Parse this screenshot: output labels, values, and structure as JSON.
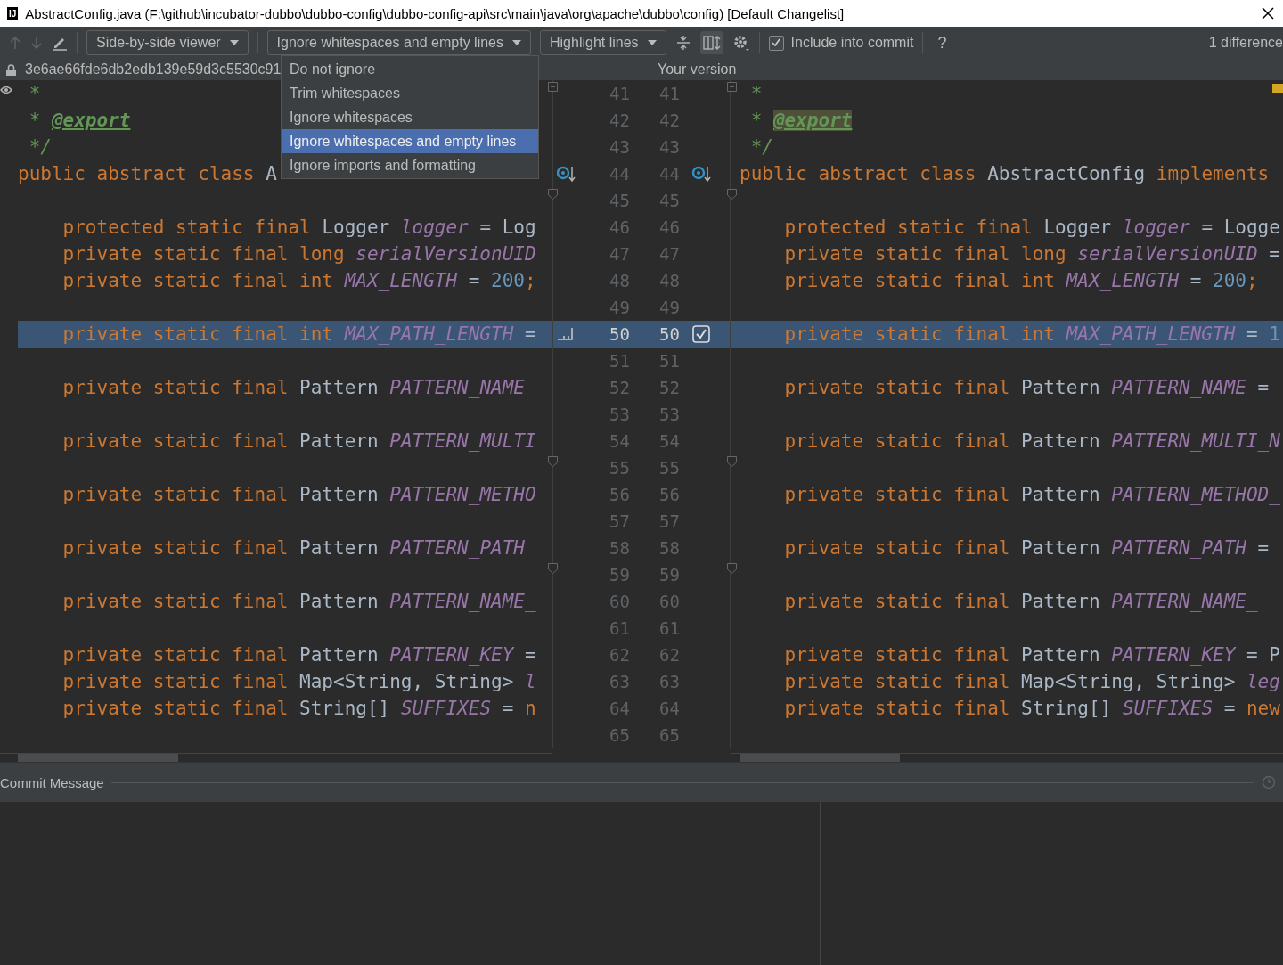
{
  "window": {
    "title": "AbstractConfig.java (F:\\github\\incubator-dubbo\\dubbo-config\\dubbo-config-api\\src\\main\\java\\org\\apache\\dubbo\\config) [Default Changelist]",
    "app_icon": "IJ"
  },
  "toolbar": {
    "viewer": "Side-by-side viewer",
    "ignore": "Ignore whitespaces and empty lines",
    "highlight": "Highlight lines",
    "include_into_commit": {
      "label": "Include into commit",
      "checked": true
    },
    "help": "?",
    "differences": "1 difference"
  },
  "ignore_menu": [
    {
      "label": "Do not ignore",
      "selected": false
    },
    {
      "label": "Trim whitespaces",
      "selected": false
    },
    {
      "label": "Ignore whitespaces",
      "selected": false
    },
    {
      "label": "Ignore whitespaces and empty lines",
      "selected": true
    },
    {
      "label": "Ignore imports and formatting",
      "selected": false
    }
  ],
  "left_header": "3e6ae66fde6db2edb139e59d3c5530c91",
  "right_header": "Your version",
  "lines": [
    {
      "left_no": "41",
      "right_no": "41",
      "fold_open": true,
      "highlighted": false,
      "left": [
        {
          "kind": "doc",
          "text": " *"
        }
      ],
      "right": [
        {
          "kind": "doc",
          "text": " *"
        }
      ]
    },
    {
      "left_no": "42",
      "right_no": "42",
      "highlighted": false,
      "left": [
        {
          "kind": "doc",
          "text": " * "
        },
        {
          "kind": "tag",
          "text": "@export"
        }
      ],
      "right": [
        {
          "kind": "doc",
          "text": " * "
        },
        {
          "kind": "tag_changed",
          "text": "@export"
        }
      ]
    },
    {
      "left_no": "43",
      "right_no": "43",
      "highlighted": false,
      "left": [
        {
          "kind": "doc",
          "text": " */"
        }
      ],
      "right": [
        {
          "kind": "doc",
          "text": " */"
        }
      ]
    },
    {
      "left_no": "44",
      "right_no": "44",
      "highlighted": false,
      "navigate": true,
      "left": [
        {
          "kind": "kw",
          "text": "public abstract class "
        },
        {
          "kind": "plain",
          "text": "A"
        }
      ],
      "right": [
        {
          "kind": "kw",
          "text": "public abstract class "
        },
        {
          "kind": "plain",
          "text": "AbstractConfig "
        },
        {
          "kind": "kw",
          "text": "implements"
        }
      ]
    },
    {
      "left_no": "45",
      "right_no": "45",
      "fold_close": true,
      "highlighted": false
    },
    {
      "left_no": "46",
      "right_no": "46",
      "highlighted": false,
      "left": [
        {
          "kind": "kw",
          "text": "    protected static final "
        },
        {
          "kind": "plain",
          "text": "Logger "
        },
        {
          "kind": "const",
          "text": "logger"
        },
        {
          "kind": "plain",
          "text": " = Log"
        }
      ],
      "right": [
        {
          "kind": "kw",
          "text": "    protected static final "
        },
        {
          "kind": "plain",
          "text": "Logger "
        },
        {
          "kind": "const",
          "text": "logger"
        },
        {
          "kind": "plain",
          "text": " = Logge"
        }
      ]
    },
    {
      "left_no": "47",
      "right_no": "47",
      "highlighted": false,
      "left": [
        {
          "kind": "kw",
          "text": "    private static final long "
        },
        {
          "kind": "const",
          "text": "serialVersionUID"
        }
      ],
      "right": [
        {
          "kind": "kw",
          "text": "    private static final long "
        },
        {
          "kind": "const",
          "text": "serialVersionUID"
        },
        {
          "kind": "plain",
          "text": " ="
        }
      ]
    },
    {
      "left_no": "48",
      "right_no": "48",
      "highlighted": false,
      "left": [
        {
          "kind": "kw",
          "text": "    private static final int "
        },
        {
          "kind": "const",
          "text": "MAX_LENGTH"
        },
        {
          "kind": "plain",
          "text": " = "
        },
        {
          "kind": "num",
          "text": "200"
        },
        {
          "kind": "kw",
          "text": ";"
        }
      ],
      "right": [
        {
          "kind": "kw",
          "text": "    private static final int "
        },
        {
          "kind": "const",
          "text": "MAX_LENGTH"
        },
        {
          "kind": "plain",
          "text": " = "
        },
        {
          "kind": "num",
          "text": "200"
        },
        {
          "kind": "kw",
          "text": ";"
        }
      ]
    },
    {
      "left_no": "49",
      "right_no": "49",
      "highlighted": false
    },
    {
      "left_no": "50",
      "right_no": "50",
      "highlighted": true,
      "checked": true,
      "left": [
        {
          "kind": "kw",
          "text": "    private static final int "
        },
        {
          "kind": "const",
          "text": "MAX_PATH_LENGTH"
        },
        {
          "kind": "plain",
          "text": " ="
        }
      ],
      "right": [
        {
          "kind": "kw",
          "text": "    private static final int "
        },
        {
          "kind": "const",
          "text": "MAX_PATH_LENGTH"
        },
        {
          "kind": "plain",
          "text": " = "
        },
        {
          "kind": "num",
          "text": "1"
        }
      ]
    },
    {
      "left_no": "51",
      "right_no": "51",
      "highlighted": false
    },
    {
      "left_no": "52",
      "right_no": "52",
      "highlighted": false,
      "left": [
        {
          "kind": "kw",
          "text": "    private static final "
        },
        {
          "kind": "plain",
          "text": "Pattern "
        },
        {
          "kind": "const",
          "text": "PATTERN_NAME"
        }
      ],
      "right": [
        {
          "kind": "kw",
          "text": "    private static final "
        },
        {
          "kind": "plain",
          "text": "Pattern "
        },
        {
          "kind": "const",
          "text": "PATTERN_NAME"
        },
        {
          "kind": "plain",
          "text": " ="
        }
      ]
    },
    {
      "left_no": "53",
      "right_no": "53",
      "highlighted": false
    },
    {
      "left_no": "54",
      "right_no": "54",
      "highlighted": false,
      "left": [
        {
          "kind": "kw",
          "text": "    private static final "
        },
        {
          "kind": "plain",
          "text": "Pattern "
        },
        {
          "kind": "const",
          "text": "PATTERN_MULTI"
        }
      ],
      "right": [
        {
          "kind": "kw",
          "text": "    private static final "
        },
        {
          "kind": "plain",
          "text": "Pattern "
        },
        {
          "kind": "const",
          "text": "PATTERN_MULTI_N"
        }
      ]
    },
    {
      "left_no": "55",
      "right_no": "55",
      "fold_close": true,
      "highlighted": false
    },
    {
      "left_no": "56",
      "right_no": "56",
      "highlighted": false,
      "left": [
        {
          "kind": "kw",
          "text": "    private static final "
        },
        {
          "kind": "plain",
          "text": "Pattern "
        },
        {
          "kind": "const",
          "text": "PATTERN_METHO"
        }
      ],
      "right": [
        {
          "kind": "kw",
          "text": "    private static final "
        },
        {
          "kind": "plain",
          "text": "Pattern "
        },
        {
          "kind": "const",
          "text": "PATTERN_METHOD_"
        }
      ]
    },
    {
      "left_no": "57",
      "right_no": "57",
      "highlighted": false
    },
    {
      "left_no": "58",
      "right_no": "58",
      "highlighted": false,
      "left": [
        {
          "kind": "kw",
          "text": "    private static final "
        },
        {
          "kind": "plain",
          "text": "Pattern "
        },
        {
          "kind": "const",
          "text": "PATTERN_PATH"
        }
      ],
      "right": [
        {
          "kind": "kw",
          "text": "    private static final "
        },
        {
          "kind": "plain",
          "text": "Pattern "
        },
        {
          "kind": "const",
          "text": "PATTERN_PATH"
        },
        {
          "kind": "plain",
          "text": " ="
        }
      ]
    },
    {
      "left_no": "59",
      "right_no": "59",
      "fold_close": true,
      "highlighted": false
    },
    {
      "left_no": "60",
      "right_no": "60",
      "highlighted": false,
      "left": [
        {
          "kind": "kw",
          "text": "    private static final "
        },
        {
          "kind": "plain",
          "text": "Pattern "
        },
        {
          "kind": "const",
          "text": "PATTERN_NAME_"
        }
      ],
      "right": [
        {
          "kind": "kw",
          "text": "    private static final "
        },
        {
          "kind": "plain",
          "text": "Pattern "
        },
        {
          "kind": "const",
          "text": "PATTERN_NAME_"
        }
      ]
    },
    {
      "left_no": "61",
      "right_no": "61",
      "highlighted": false
    },
    {
      "left_no": "62",
      "right_no": "62",
      "highlighted": false,
      "left": [
        {
          "kind": "kw",
          "text": "    private static final "
        },
        {
          "kind": "plain",
          "text": "Pattern "
        },
        {
          "kind": "const",
          "text": "PATTERN_KEY"
        },
        {
          "kind": "plain",
          "text": " ="
        }
      ],
      "right": [
        {
          "kind": "kw",
          "text": "    private static final "
        },
        {
          "kind": "plain",
          "text": "Pattern "
        },
        {
          "kind": "const",
          "text": "PATTERN_KEY"
        },
        {
          "kind": "plain",
          "text": " = P"
        }
      ]
    },
    {
      "left_no": "63",
      "right_no": "63",
      "highlighted": false,
      "left": [
        {
          "kind": "kw",
          "text": "    private static final "
        },
        {
          "kind": "plain",
          "text": "Map<String, String> "
        },
        {
          "kind": "const",
          "text": "l"
        }
      ],
      "right": [
        {
          "kind": "kw",
          "text": "    private static final "
        },
        {
          "kind": "plain",
          "text": "Map<String, String> "
        },
        {
          "kind": "const",
          "text": "leg"
        }
      ]
    },
    {
      "left_no": "64",
      "right_no": "64",
      "highlighted": false,
      "left": [
        {
          "kind": "kw",
          "text": "    private static final "
        },
        {
          "kind": "plain",
          "text": "String[] "
        },
        {
          "kind": "const",
          "text": "SUFFIXES"
        },
        {
          "kind": "plain",
          "text": " = "
        },
        {
          "kind": "kw",
          "text": "n"
        }
      ],
      "right": [
        {
          "kind": "kw",
          "text": "    private static final "
        },
        {
          "kind": "plain",
          "text": "String[] "
        },
        {
          "kind": "const",
          "text": "SUFFIXES"
        },
        {
          "kind": "plain",
          "text": " = "
        },
        {
          "kind": "kw",
          "text": "new"
        }
      ]
    },
    {
      "left_no": "65",
      "right_no": "65",
      "highlighted": false
    }
  ],
  "commit_panel": {
    "title": "Commit Message"
  }
}
